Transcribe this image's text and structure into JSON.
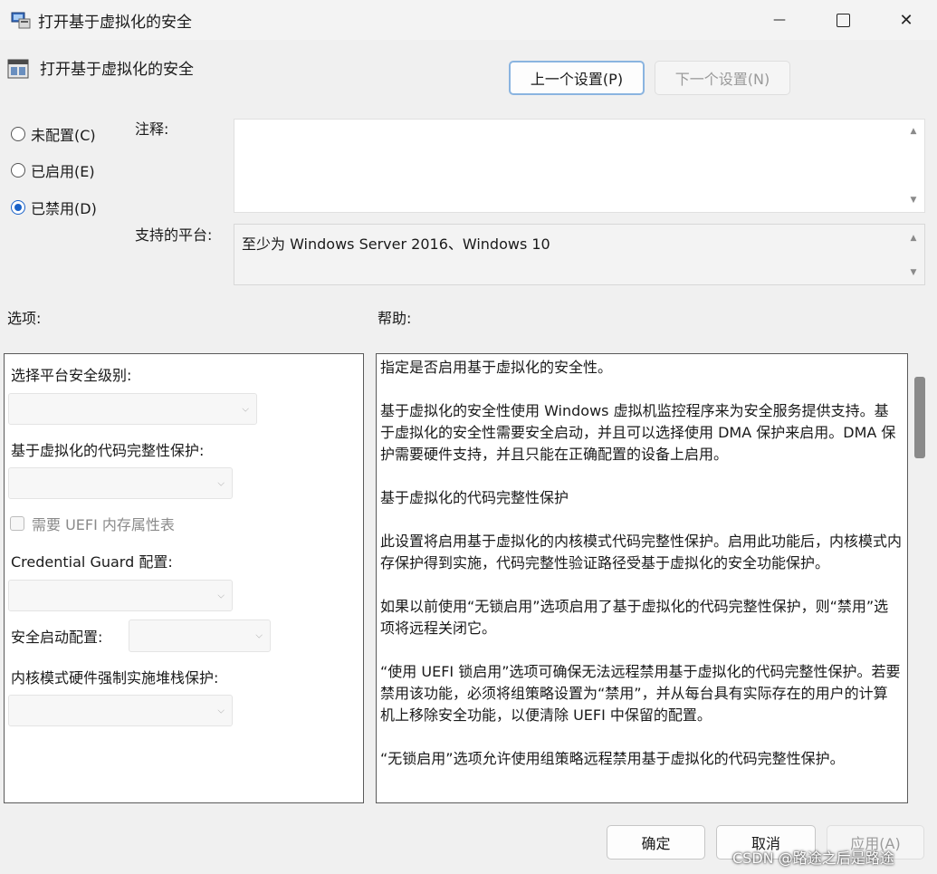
{
  "window": {
    "title": "打开基于虚拟化的安全",
    "minimize_glyph": "—",
    "maximize_glyph": "☐",
    "close_glyph": "✕"
  },
  "header": {
    "title": "打开基于虚拟化的安全",
    "prev_button": "上一个设置(P)",
    "next_button": "下一个设置(N)"
  },
  "state": {
    "options": [
      {
        "label": "未配置(C)",
        "checked": false
      },
      {
        "label": "已启用(E)",
        "checked": false
      },
      {
        "label": "已禁用(D)",
        "checked": true
      }
    ]
  },
  "comment": {
    "label": "注释:",
    "value": ""
  },
  "platform": {
    "label": "支持的平台:",
    "value": "至少为 Windows Server 2016、Windows 10"
  },
  "options_section": {
    "label": "选项:",
    "platform_level_label": "选择平台安全级别:",
    "code_integrity_label": "基于虚拟化的代码完整性保护:",
    "uefi_checkbox_label": "需要 UEFI 内存属性表",
    "credential_guard_label": "Credential Guard 配置:",
    "secure_launch_label": "安全启动配置:",
    "kernel_stack_label": "内核模式硬件强制实施堆栈保护:"
  },
  "help_section": {
    "label": "帮助:",
    "paragraphs": [
      "指定是否启用基于虚拟化的安全性。",
      "基于虚拟化的安全性使用 Windows 虚拟机监控程序来为安全服务提供支持。基于虚拟化的安全性需要安全启动，并且可以选择使用 DMA 保护来启用。DMA 保护需要硬件支持，并且只能在正确配置的设备上启用。",
      "基于虚拟化的代码完整性保护",
      "此设置将启用基于虚拟化的内核模式代码完整性保护。启用此功能后，内核模式内存保护得到实施，代码完整性验证路径受基于虚拟化的安全功能保护。",
      "如果以前使用“无锁启用”选项启用了基于虚拟化的代码完整性保护，则“禁用”选项将远程关闭它。",
      "“使用 UEFI 锁启用”选项可确保无法远程禁用基于虚拟化的代码完整性保护。若要禁用该功能，必须将组策略设置为“禁用”，并从每台具有实际存在的用户的计算机上移除安全功能，以便清除 UEFI 中保留的配置。",
      "“无锁启用”选项允许使用组策略远程禁用基于虚拟化的代码完整性保护。"
    ]
  },
  "footer": {
    "ok_button": "确定",
    "cancel_button": "取消",
    "apply_button": "应用(A)"
  },
  "watermark": "CSDN @路途之后是路途",
  "colors": {
    "accent": "#1a62c8",
    "background": "#f0f0f0"
  }
}
